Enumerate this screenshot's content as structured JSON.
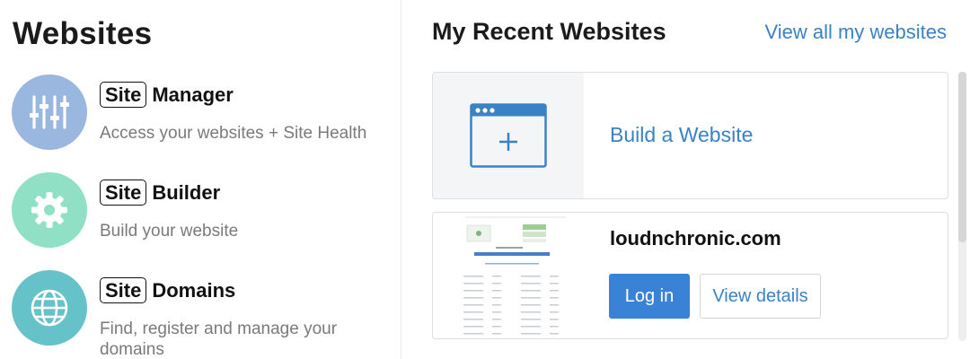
{
  "left": {
    "title": "Websites",
    "services": [
      {
        "badge": "Site",
        "name": "Manager",
        "description": "Access your websites + Site Health",
        "icon": "sliders-icon",
        "color": "#9ab7e0"
      },
      {
        "badge": "Site",
        "name": "Builder",
        "description": "Build your website",
        "icon": "gear-icon",
        "color": "#8fe0c4"
      },
      {
        "badge": "Site",
        "name": "Domains",
        "description": "Find, register and manage your domains",
        "icon": "globe-icon",
        "color": "#66c2c9"
      }
    ]
  },
  "right": {
    "title": "My Recent Websites",
    "view_all": "View all my websites",
    "build_card": {
      "link": "Build a Website",
      "icon": "browser-add-icon"
    },
    "site_card": {
      "domain": "loudnchronic.com",
      "login_label": "Log in",
      "details_label": "View details"
    }
  },
  "colors": {
    "accent": "#3a82c6",
    "primary_button": "#3a82d6"
  }
}
